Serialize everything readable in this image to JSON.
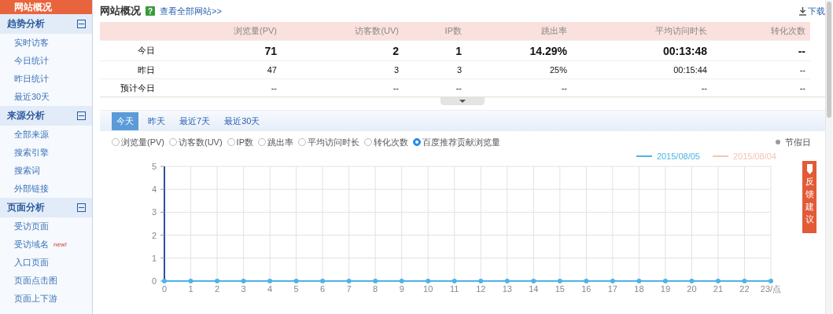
{
  "sidebar": {
    "items": [
      {
        "label": "网站概况",
        "selected": true
      }
    ],
    "sections": [
      {
        "title": "趋势分析",
        "expanded": true,
        "items": [
          {
            "label": "实时访客"
          },
          {
            "label": "今日统计"
          },
          {
            "label": "昨日统计"
          },
          {
            "label": "最近30天"
          }
        ]
      },
      {
        "title": "来源分析",
        "expanded": true,
        "items": [
          {
            "label": "全部来源"
          },
          {
            "label": "搜索引擎"
          },
          {
            "label": "搜索词"
          },
          {
            "label": "外部链接"
          }
        ]
      },
      {
        "title": "页面分析",
        "expanded": true,
        "items": [
          {
            "label": "受访页面"
          },
          {
            "label": "受访域名",
            "badge": "new!"
          },
          {
            "label": "入口页面"
          },
          {
            "label": "页面点击图"
          },
          {
            "label": "页面上下游"
          }
        ]
      }
    ]
  },
  "header": {
    "title": "网站概况",
    "help": "?",
    "link": "查看全部网站>>",
    "download": "下载"
  },
  "table": {
    "columns": [
      "浏览量(PV)",
      "访客数(UV)",
      "IP数",
      "跳出率",
      "平均访问时长",
      "转化次数"
    ],
    "rows": [
      {
        "label": "今日",
        "emphasized": true,
        "cells": [
          "71",
          "2",
          "1",
          "14.29%",
          "00:13:48",
          "--"
        ]
      },
      {
        "label": "昨日",
        "emphasized": false,
        "cells": [
          "47",
          "3",
          "3",
          "25%",
          "00:15:44",
          "--"
        ]
      },
      {
        "label": "预计今日",
        "emphasized": false,
        "cells": [
          "--",
          "--",
          "--",
          "--",
          "--",
          "--"
        ]
      }
    ]
  },
  "period_tabs": [
    {
      "label": "今天",
      "selected": true
    },
    {
      "label": "昨天",
      "selected": false
    },
    {
      "label": "最近7天",
      "selected": false
    },
    {
      "label": "最近30天",
      "selected": false
    }
  ],
  "metrics": [
    {
      "label": "浏览量(PV)",
      "selected": false
    },
    {
      "label": "访客数(UV)",
      "selected": false
    },
    {
      "label": "IP数",
      "selected": false
    },
    {
      "label": "跳出率",
      "selected": false
    },
    {
      "label": "平均访问时长",
      "selected": false
    },
    {
      "label": "转化次数",
      "selected": false
    },
    {
      "label": "百度推荐贡献浏览量",
      "selected": true
    }
  ],
  "holiday_legend": {
    "label": "节假日"
  },
  "chart": {
    "chart_data": {
      "type": "line",
      "categories": [
        "0",
        "1",
        "2",
        "3",
        "4",
        "5",
        "6",
        "7",
        "8",
        "9",
        "10",
        "11",
        "12",
        "13",
        "14",
        "15",
        "16",
        "17",
        "18",
        "19",
        "20",
        "21",
        "22",
        "23/点"
      ],
      "grid": true,
      "series": [
        {
          "name": "2015/08/05",
          "color": "#4db3e6",
          "marker": true,
          "values": [
            0,
            0,
            0,
            0,
            0,
            0,
            0,
            0,
            0,
            0,
            0,
            0,
            0,
            0,
            0,
            0,
            0,
            0,
            0,
            0,
            0,
            0,
            0,
            0
          ]
        },
        {
          "name": "2015/08/04",
          "color": "#f4c4b6",
          "values": [
            null,
            null,
            null,
            null,
            null,
            null,
            null,
            null,
            null,
            null,
            null,
            null,
            null,
            null,
            null,
            null,
            null,
            null,
            null,
            null,
            null,
            null,
            null,
            null
          ]
        }
      ],
      "ylim": [
        0,
        5
      ],
      "yticks": [
        0,
        1,
        2,
        3,
        4,
        5
      ]
    }
  },
  "feedback": {
    "label": "反馈建议"
  }
}
